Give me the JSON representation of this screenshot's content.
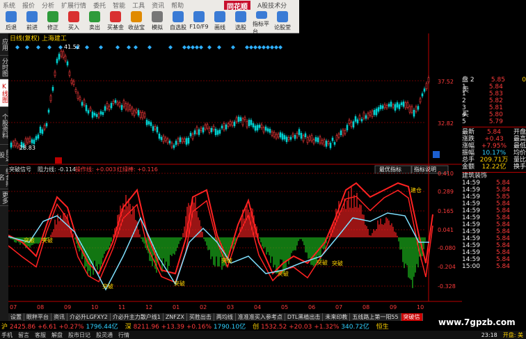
{
  "menu": [
    "系统",
    "报价",
    "分析",
    "扩展行情",
    "委托",
    "智能",
    "工具",
    "资讯",
    "帮助"
  ],
  "brand": {
    "logo": "同花顺",
    "subtitle": "A股技术分"
  },
  "toolbar": [
    {
      "label": "后退",
      "icon": "back-icon",
      "color": "#3a7bd5"
    },
    {
      "label": "前进",
      "icon": "forward-icon",
      "color": "#3a7bd5"
    },
    {
      "label": "修正",
      "icon": "fix-icon",
      "color": "#2e9b3a"
    },
    {
      "label": "买入",
      "icon": "buy-icon",
      "color": "#d93030"
    },
    {
      "label": "卖出",
      "icon": "sell-icon",
      "color": "#2e9b3a"
    },
    {
      "label": "买基金",
      "icon": "fund-icon",
      "color": "#d93030"
    },
    {
      "label": "收益宝",
      "icon": "money-icon",
      "color": "#e08a00"
    },
    {
      "label": "模拟",
      "icon": "sim-icon",
      "color": "#777"
    },
    {
      "label": "自选股",
      "icon": "star-icon",
      "color": "#3a7bd5"
    },
    {
      "label": "F10/F9",
      "icon": "f10-icon",
      "color": "#3a7bd5"
    },
    {
      "label": "画线",
      "icon": "draw-icon",
      "color": "#3a7bd5"
    },
    {
      "label": "选股",
      "icon": "pick-icon",
      "color": "#3a7bd5"
    },
    {
      "label": "指标平台",
      "icon": "index-icon",
      "color": "#3a7bd5"
    },
    {
      "label": "论股堂",
      "icon": "chat-icon",
      "color": "#3a7bd5"
    }
  ],
  "sidebar": [
    "应用",
    "分时图",
    "K线图",
    "个股资料",
    "自选股",
    "综合排名",
    "更多"
  ],
  "kchart": {
    "title": "日线(复权) 上海建工",
    "high_label": "41.52",
    "low_label": "28.83",
    "axis": [
      "37.52",
      "32.82"
    ]
  },
  "indicator": {
    "header_name": "突破信号",
    "header_v1": "阻力线: -0.114",
    "header_v2": "操作线: +0.003",
    "header_v3": "红绿棒: +0.116",
    "buttons": [
      "最优指标",
      "指标说明"
    ],
    "axis": [
      "0.410",
      "0.289",
      "0.165",
      "0.041",
      "-0.080",
      "-0.204",
      "-0.328"
    ],
    "markers": [
      "突破",
      "突破",
      "突破",
      "突破",
      "突破",
      "突破",
      "突破",
      "突破",
      "建仓"
    ]
  },
  "months": [
    "07",
    "08",
    "09",
    "10",
    "11",
    "12",
    "01",
    "02",
    "03",
    "04",
    "05",
    "06",
    "07",
    "08",
    "09",
    "10"
  ],
  "orderbook": {
    "sell": [
      {
        "lvl": "盘 2",
        "p": "5.85",
        "v": "0"
      },
      {
        "lvl": "1",
        "p": "5.84",
        "v": ""
      }
    ],
    "buy": [
      {
        "lvl": "1",
        "p": "5.83"
      },
      {
        "lvl": "2",
        "p": "5.82"
      },
      {
        "lvl": "3",
        "p": "5.81"
      },
      {
        "lvl": "4",
        "p": "5.80"
      },
      {
        "lvl": "5",
        "p": "5.79"
      }
    ],
    "side_sell": "卖",
    "side_buy": "买"
  },
  "quote": [
    {
      "k": "最新",
      "v": "5.84",
      "k2": "开盘"
    },
    {
      "k": "涨跌",
      "v": "+0.43",
      "k2": "最高"
    },
    {
      "k": "涨幅",
      "v": "+7.95%",
      "k2": "最低"
    },
    {
      "k": "振幅",
      "v": "10.17%",
      "k2": "均价"
    },
    {
      "k": "总手",
      "v": "209.71万",
      "k2": "量比"
    },
    {
      "k": "金额",
      "v": "12.22亿",
      "k2": "换手"
    }
  ],
  "sector": "建筑装饰",
  "ticks": [
    {
      "t": "14:59",
      "p": "5.84"
    },
    {
      "t": "14:59",
      "p": "5.84"
    },
    {
      "t": "14:59",
      "p": "5.85"
    },
    {
      "t": "14:59",
      "p": "5.84"
    },
    {
      "t": "14:59",
      "p": "5.84"
    },
    {
      "t": "14:59",
      "p": "5.84"
    },
    {
      "t": "14:59",
      "p": "5.84"
    },
    {
      "t": "14:59",
      "p": "5.84"
    },
    {
      "t": "14:59",
      "p": "5.84"
    },
    {
      "t": "14:59",
      "p": "5.84"
    },
    {
      "t": "14:59",
      "p": "5.84"
    },
    {
      "t": "14:59",
      "p": "5.84"
    },
    {
      "t": "15:00",
      "p": "5.84"
    }
  ],
  "tabs": [
    "设置",
    "眼秤平台",
    "资讯",
    "介必升LGFXY2",
    "介必升主力散户线1",
    "ZNFZX",
    "买胜出击",
    "两均线",
    "准准准买入参考点",
    "DTL黑植出击",
    "未来印教",
    "五线路上第一阳55",
    "突破信"
  ],
  "ticker": [
    {
      "name": "沪",
      "val": "2425.86",
      "chg": "+6.61",
      "pct": "+0.27%",
      "amt": "1796.44亿"
    },
    {
      "name": "深",
      "val": "8211.96",
      "chg": "+13.39",
      "pct": "+0.16%",
      "amt": "1790.10亿"
    },
    {
      "name": "创",
      "val": "1532.52",
      "chg": "+20.03",
      "pct": "+1.32%",
      "amt": "340.72亿"
    },
    {
      "name": "恒生",
      "val": "",
      "chg": "",
      "pct": "",
      "amt": ""
    }
  ],
  "status": [
    "手机",
    "留言",
    "客服",
    "解盘",
    "股市日记",
    "股灵通",
    "行情"
  ],
  "status_time": "23:18",
  "status_right": "开盘: 美",
  "watermark": "www.7gpzb.com"
}
